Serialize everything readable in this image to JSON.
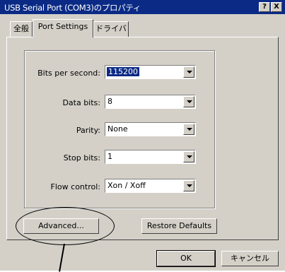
{
  "window": {
    "title": "USB Serial Port (COM3)のプロパティ",
    "help_label": "?",
    "close_label": "X"
  },
  "tabs": [
    {
      "label": "全般",
      "active": false
    },
    {
      "label": "Port Settings",
      "active": true
    },
    {
      "label": "ドライバ",
      "active": false
    }
  ],
  "settings": {
    "bits_per_second": {
      "label": "Bits per second:",
      "value": "115200"
    },
    "data_bits": {
      "label": "Data bits:",
      "value": "8"
    },
    "parity": {
      "label": "Parity:",
      "value": "None"
    },
    "stop_bits": {
      "label": "Stop bits:",
      "value": "1"
    },
    "flow_control": {
      "label": "Flow control:",
      "value": "Xon / Xoff"
    }
  },
  "buttons": {
    "advanced": "Advanced...",
    "restore_defaults": "Restore Defaults",
    "ok": "OK",
    "cancel": "キャンセル"
  }
}
